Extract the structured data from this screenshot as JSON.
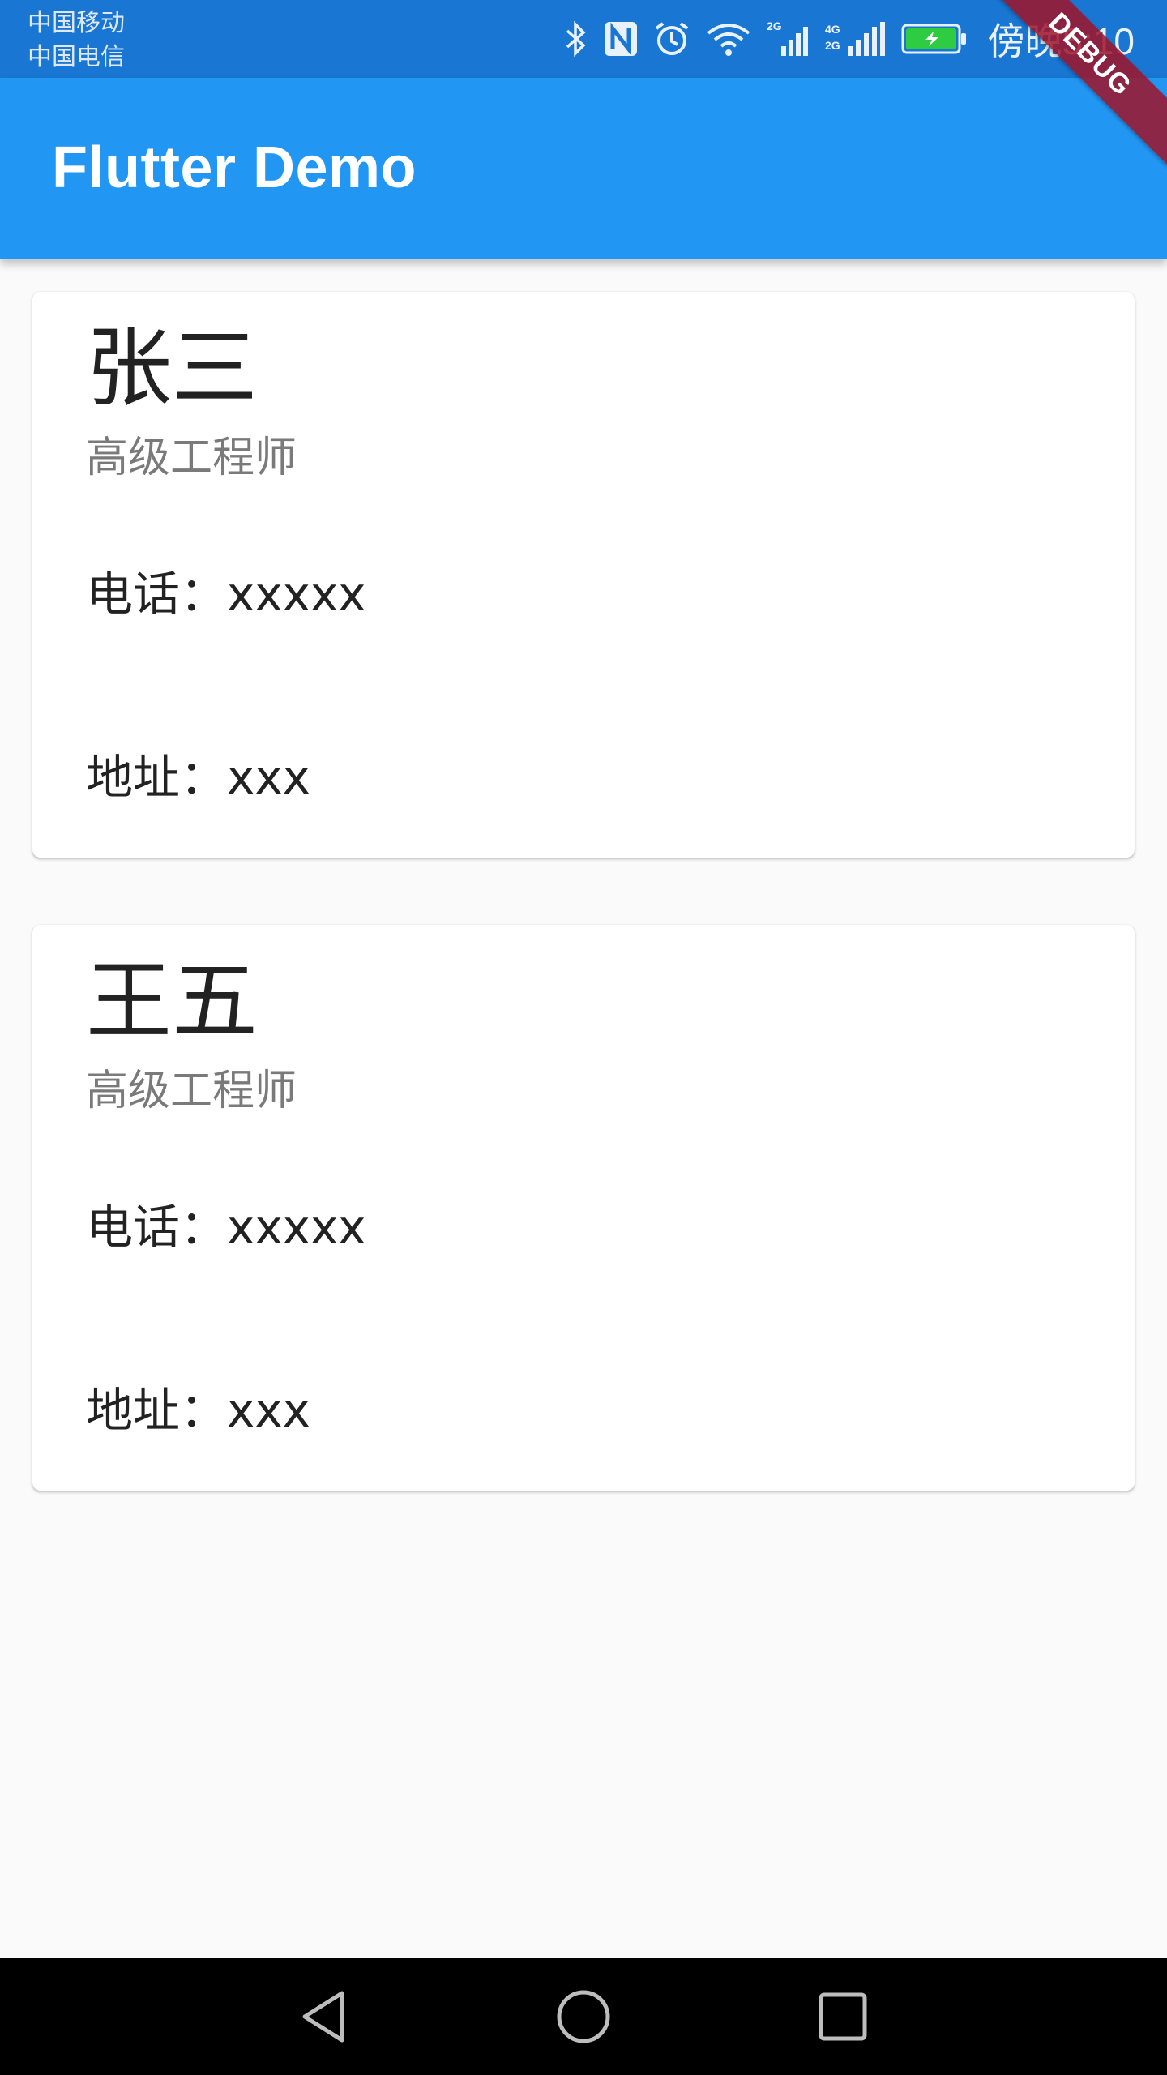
{
  "status_bar": {
    "carrier1": "中国移动",
    "carrier2": "中国电信",
    "time": "傍晚5:10",
    "icons": [
      "bluetooth-icon",
      "nfc-icon",
      "alarm-icon",
      "wifi-icon",
      "signal-2g-icon",
      "signal-4g-2g-icon",
      "battery-charging-icon"
    ]
  },
  "app_bar": {
    "title": "Flutter Demo",
    "color": "#2196f3"
  },
  "debug_banner": "DEBUG",
  "cards": [
    {
      "name": "张三",
      "title": "高级工程师",
      "phone": "电话：xxxxx",
      "address": "地址：xxx"
    },
    {
      "name": "王五",
      "title": "高级工程师",
      "phone": "电话：xxxxx",
      "address": "地址：xxx"
    }
  ],
  "nav_bar": {
    "buttons": [
      "back-icon",
      "home-icon",
      "recents-icon"
    ]
  }
}
